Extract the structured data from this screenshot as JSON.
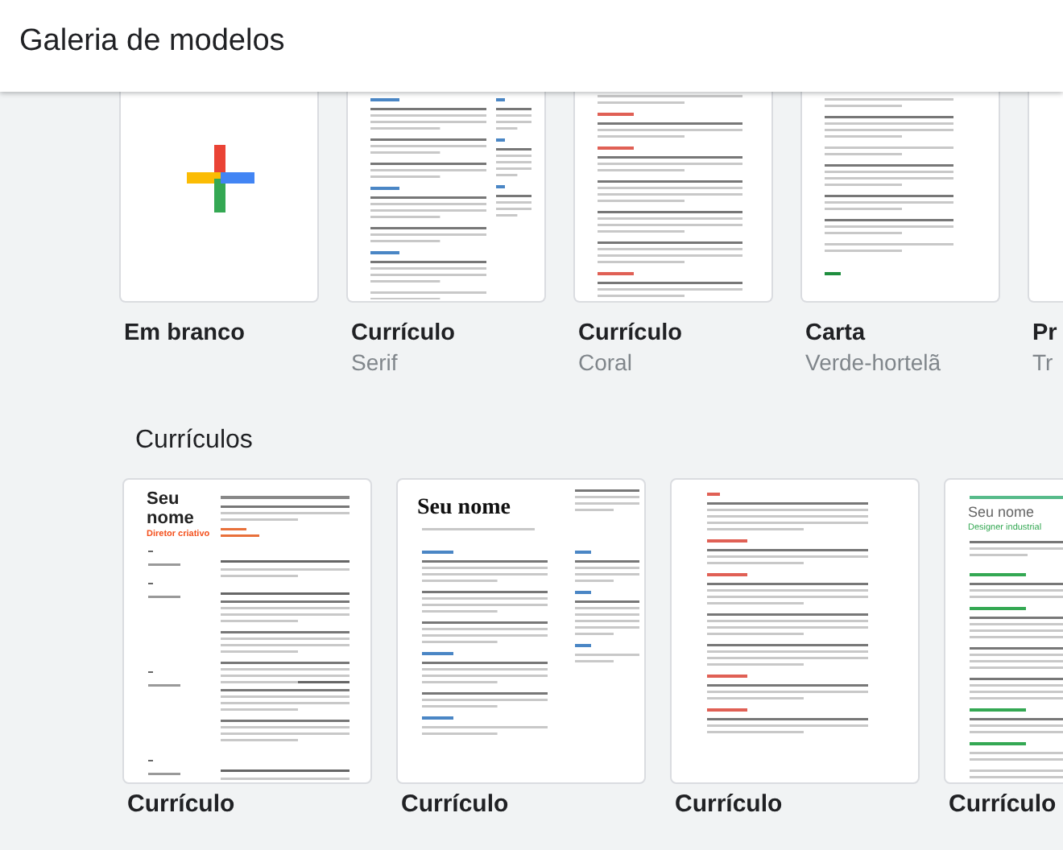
{
  "header": {
    "title": "Galeria de modelos"
  },
  "recent": [
    {
      "name": "Em branco",
      "kind": "blank"
    },
    {
      "name": "Currículo",
      "subtitle": "Serif",
      "kind": "serif-top"
    },
    {
      "name": "Currículo",
      "subtitle": "Coral",
      "kind": "coral-top"
    },
    {
      "name": "Carta",
      "subtitle": "Verde-hortelã",
      "kind": "letter"
    },
    {
      "name": "Pr",
      "subtitle": "Tr",
      "kind": "empty"
    }
  ],
  "section": {
    "title": "Currículos",
    "templates": [
      {
        "name": "Currículo",
        "kind": "swiss",
        "heading": "Seu nome",
        "tagline": "Diretor criativo"
      },
      {
        "name": "Currículo",
        "kind": "serif",
        "heading": "Seu nome"
      },
      {
        "name": "Currículo",
        "kind": "coral"
      },
      {
        "name": "Currículo",
        "kind": "modern",
        "heading": "Seu nome",
        "tagline": "Designer industrial"
      }
    ]
  }
}
